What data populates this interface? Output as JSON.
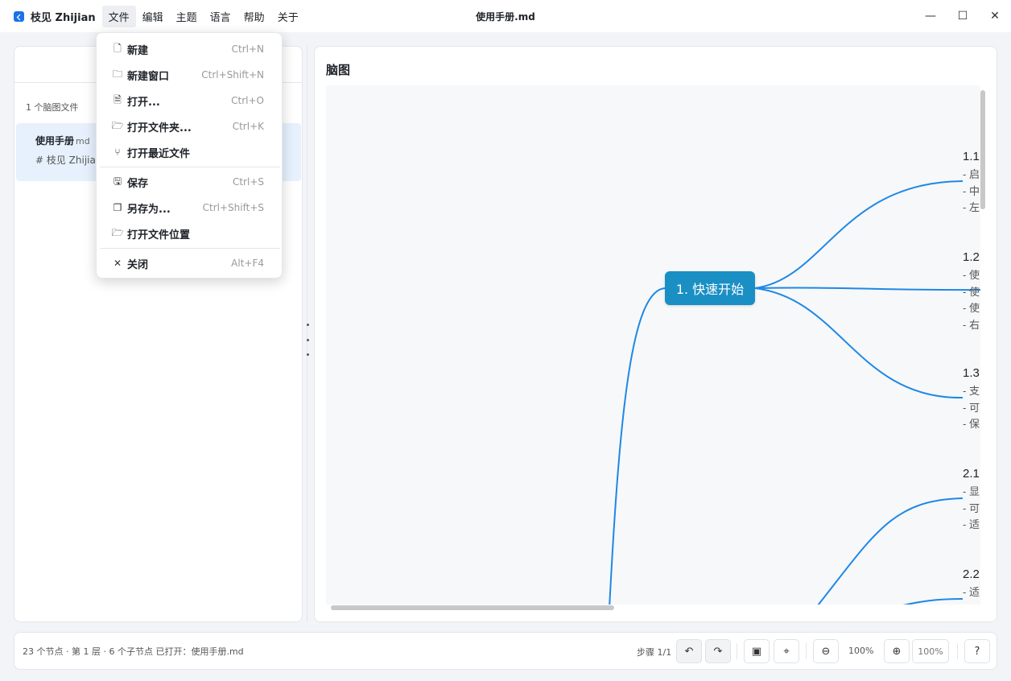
{
  "app": {
    "name": "枝见 Zhijian",
    "window_title": "使用手册.md"
  },
  "menubar": [
    {
      "label": "文件",
      "active": true
    },
    {
      "label": "编辑"
    },
    {
      "label": "主题"
    },
    {
      "label": "语言"
    },
    {
      "label": "帮助"
    },
    {
      "label": "关于"
    }
  ],
  "window_controls": {
    "minimize": "—",
    "maximize": "☐",
    "close": "✕"
  },
  "file_menu": {
    "items": [
      {
        "label": "新建",
        "shortcut": "Ctrl+N",
        "icon": "new-file-icon",
        "glyph": "🗋"
      },
      {
        "label": "新建窗口",
        "shortcut": "Ctrl+Shift+N",
        "icon": "new-window-icon",
        "glyph": "🗀"
      },
      {
        "label": "打开...",
        "shortcut": "Ctrl+O",
        "icon": "open-file-icon",
        "glyph": "🗎"
      },
      {
        "label": "打开文件夹...",
        "shortcut": "Ctrl+K",
        "icon": "open-folder-icon",
        "glyph": "🗁"
      },
      {
        "label": "打开最近文件",
        "shortcut": "",
        "icon": "recent-files-icon",
        "glyph": "⑂"
      },
      {
        "label": "保存",
        "shortcut": "Ctrl+S",
        "icon": "save-icon",
        "glyph": "🖫"
      },
      {
        "label": "另存为...",
        "shortcut": "Ctrl+Shift+S",
        "icon": "save-as-icon",
        "glyph": "❐"
      },
      {
        "label": "打开文件位置",
        "shortcut": "",
        "icon": "file-location-icon",
        "glyph": "🗁"
      },
      {
        "label": "关闭",
        "shortcut": "Alt+F4",
        "icon": "close-icon",
        "glyph": "✕"
      }
    ]
  },
  "sidebar": {
    "file_count": "1 个脑图文件",
    "files": [
      {
        "name": "使用手册",
        "ext": "md",
        "snippet": "# 枝见 Zhijian"
      }
    ]
  },
  "mindmap": {
    "panel_title": "脑图",
    "root": "1. 快速开始",
    "branches": [
      {
        "title": "1.1",
        "lines": [
          "- 启",
          "- 中",
          "- 左"
        ]
      },
      {
        "title": "1.2",
        "lines": [
          "- 使",
          "- 使",
          "- 使",
          "- 右"
        ]
      },
      {
        "title": "1.3",
        "lines": [
          "- 支",
          "- 可",
          "- 保"
        ]
      },
      {
        "title": "2.1",
        "lines": [
          "- 显",
          "- 可",
          "- 适"
        ]
      },
      {
        "title": "2.2",
        "lines": [
          "- 适"
        ]
      }
    ],
    "colors": {
      "link": "#1e88e5",
      "root_fill": "#1a8fc4"
    }
  },
  "statusbar": {
    "info": "23 个节点 · 第 1 层 · 6 个子节点    已打开：使用手册.md",
    "step_label": "步骤 1/1",
    "undo_icon": "↶",
    "redo_icon": "↷",
    "image_icon": "▣",
    "locate_icon": "⌖",
    "zoom_out_icon": "⊖",
    "zoom_level": "100%",
    "zoom_in_icon": "⊕",
    "reset_zoom": "100%",
    "help_icon": "?"
  }
}
